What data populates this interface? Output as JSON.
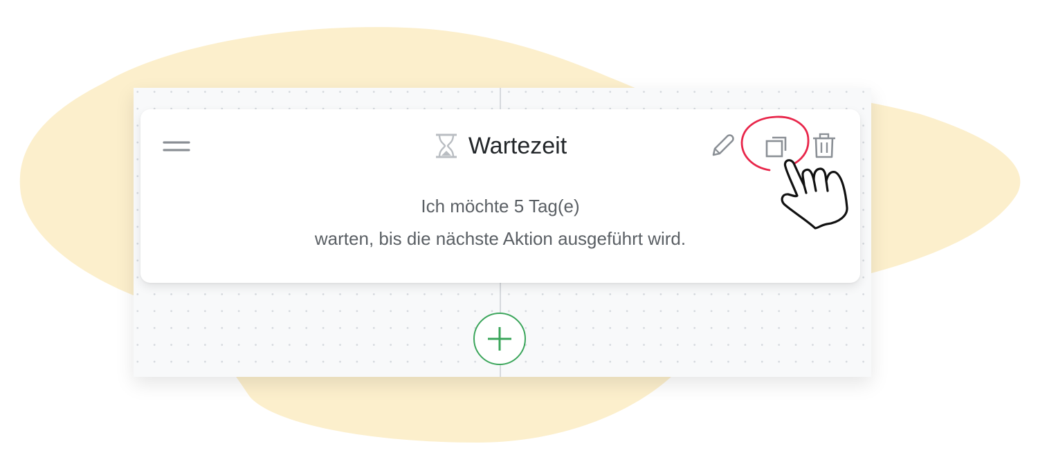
{
  "colors": {
    "background_blob": "#fcefcc",
    "panel": "#f8f9fa",
    "card": "#ffffff",
    "title_text": "#222629",
    "body_text": "#5a5f64",
    "icon_gray": "#8a8f95",
    "add_accent": "#3aa55a",
    "highlight_circle": "#e8264a"
  },
  "card": {
    "title": "Wartezeit",
    "icon": "hourglass-icon",
    "description_line1": "Ich möchte 5 Tag(e)",
    "description_line2": "warten, bis die nächste Aktion ausgeführt wird.",
    "actions": [
      {
        "name": "edit",
        "icon": "pencil-icon"
      },
      {
        "name": "duplicate",
        "icon": "copy-icon",
        "highlighted": true
      },
      {
        "name": "delete",
        "icon": "trash-icon"
      }
    ]
  },
  "add_step": {
    "icon": "plus-icon"
  },
  "annotation": {
    "pointer": "hand-pointer-icon"
  }
}
